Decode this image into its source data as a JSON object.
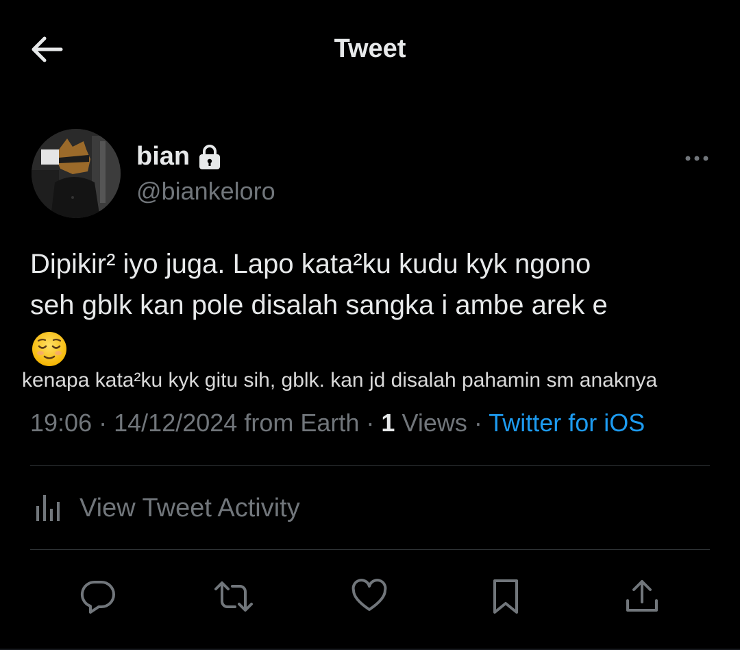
{
  "header": {
    "title": "Tweet",
    "back_icon": "arrow-left-icon"
  },
  "author": {
    "display_name": "bian",
    "handle": "@biankeloro",
    "protected_icon": "lock-icon"
  },
  "tweet": {
    "text": "Dipikir² iyo juga. Lapo kata²ku kudu kyk ngono\nseh gblk kan pole disalah sangka i ambe arek e",
    "emoji": "relieved-face-emoji",
    "translation": "kenapa kata²ku kyk gitu sih, gblk. kan jd disalah pahamin sm anaknya"
  },
  "meta": {
    "time": "19:06",
    "date": "14/12/2024",
    "location": "from Earth",
    "views_count": "1",
    "views_label": "Views",
    "source": "Twitter for iOS",
    "separator": "·"
  },
  "activity": {
    "label": "View Tweet Activity",
    "icon": "analytics-icon"
  },
  "actions": [
    {
      "name": "reply",
      "icon": "reply-icon"
    },
    {
      "name": "retweet",
      "icon": "retweet-icon"
    },
    {
      "name": "like",
      "icon": "heart-icon"
    },
    {
      "name": "bookmark",
      "icon": "bookmark-icon"
    },
    {
      "name": "share",
      "icon": "share-icon"
    }
  ],
  "colors": {
    "background": "#000000",
    "text_primary": "#e7e9ea",
    "text_secondary": "#71767b",
    "link": "#1d9bf0",
    "divider": "#2f3336"
  }
}
